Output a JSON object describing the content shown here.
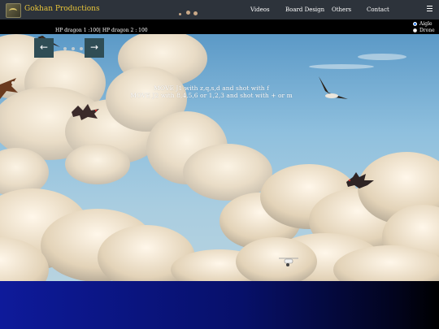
{
  "navbar": {
    "brand": "Gokhan Productions",
    "links": [
      "Videos",
      "Board Design",
      "Others",
      "Contact"
    ],
    "menu_icon": "hamburger-menu-icon"
  },
  "hud": {
    "hp_text": "HP dragon 1 :100| HP dragon 2 : 100",
    "character_options": [
      {
        "label": "Aigle",
        "selected": true
      },
      {
        "label": "Drone",
        "selected": false
      }
    ]
  },
  "carousel": {
    "prev_icon": "arrow-left-icon",
    "next_icon": "arrow-right-icon",
    "prev_glyph": "←",
    "next_glyph": "→",
    "active_slide": 0,
    "slide_count": 3
  },
  "instructions": {
    "line1": "MOVE J1 with z,q,s,d and shot with f",
    "line2": "MOVE J2 with 8,4,5,6 or 1,2,3 and shot with + or m"
  },
  "colors": {
    "navbar": "#2d333b",
    "brand": "#e8c53a",
    "arrow_button": "#2f4d55",
    "radio_selected": "#3b8bf6",
    "footer_start": "#0e1a9a",
    "footer_end": "#000000"
  }
}
